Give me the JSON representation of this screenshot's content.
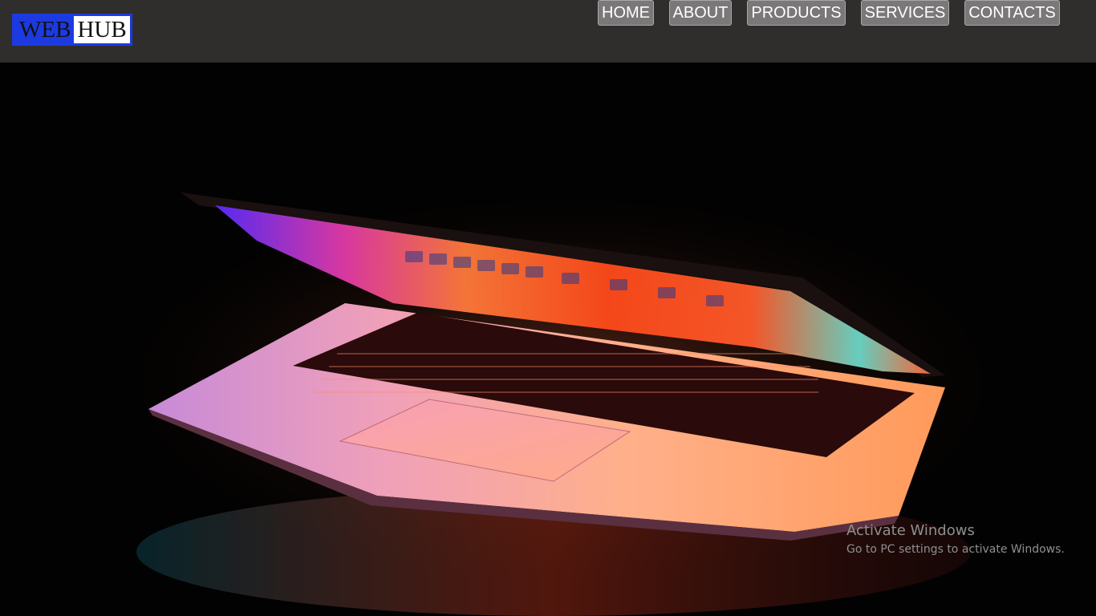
{
  "logo": {
    "part1": "WEB",
    "part2": "HUB"
  },
  "nav": {
    "items": [
      {
        "label": "HOME"
      },
      {
        "label": "ABOUT"
      },
      {
        "label": "PRODUCTS"
      },
      {
        "label": "SERVICES"
      },
      {
        "label": "CONTACTS"
      }
    ]
  },
  "hero": {
    "image": "laptop-backlit-keyboard-photo"
  },
  "watermark": {
    "title": "Activate Windows",
    "subtitle": "Go to PC settings to activate Windows."
  },
  "colors": {
    "header_bg": "#302d2d",
    "nav_button_bg": "#7a7878",
    "logo_blue": "#1d3ae0",
    "page_bg": "#000000"
  }
}
